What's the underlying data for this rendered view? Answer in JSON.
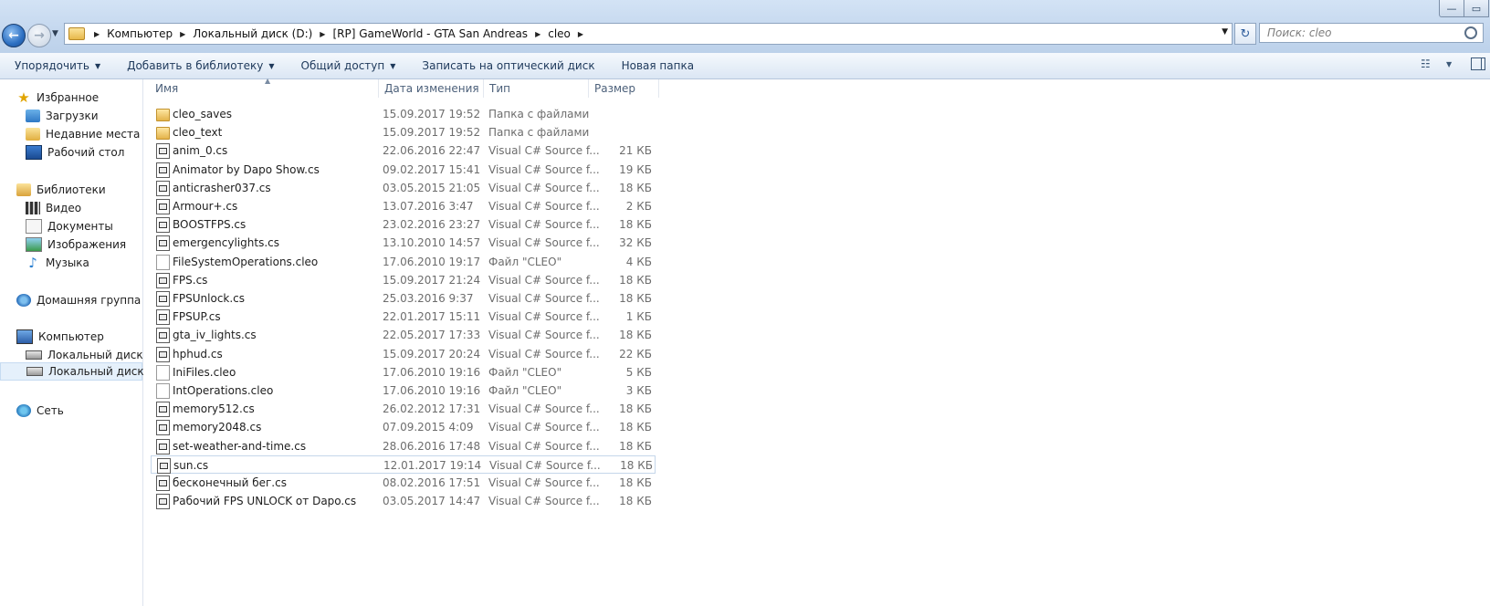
{
  "window": {
    "minimize_glyph": "—",
    "maximize_glyph": "▭"
  },
  "address": {
    "crumbs": [
      "Компьютер",
      "Локальный диск (D:)",
      "[RP] GameWorld - GTA San Andreas",
      "cleo"
    ]
  },
  "search": {
    "placeholder": "Поиск: cleo"
  },
  "commands": {
    "organize": "Упорядочить",
    "add_to_library": "Добавить в библиотеку",
    "share": "Общий доступ",
    "burn": "Записать на оптический диск",
    "new_folder": "Новая папка"
  },
  "nav": {
    "favorites": "Избранное",
    "downloads": "Загрузки",
    "recent": "Недавние места",
    "desktop": "Рабочий стол",
    "libraries": "Библиотеки",
    "video": "Видео",
    "documents": "Документы",
    "images": "Изображения",
    "music": "Музыка",
    "homegroup": "Домашняя группа",
    "computer": "Компьютер",
    "disk_c": "Локальный диск (C",
    "disk_d": "Локальный диск (D",
    "network": "Сеть"
  },
  "columns": {
    "name": "Имя",
    "date": "Дата изменения",
    "type": "Тип",
    "size": "Размер"
  },
  "files": [
    {
      "name": "cleo_saves",
      "date": "15.09.2017 19:52",
      "type": "Папка с файлами",
      "size": "",
      "kind": "folder"
    },
    {
      "name": "cleo_text",
      "date": "15.09.2017 19:52",
      "type": "Папка с файлами",
      "size": "",
      "kind": "folder"
    },
    {
      "name": "anim_0.cs",
      "date": "22.06.2016 22:47",
      "type": "Visual C# Source f...",
      "size": "21 КБ",
      "kind": "cs"
    },
    {
      "name": "Animator by Dapo Show.cs",
      "date": "09.02.2017 15:41",
      "type": "Visual C# Source f...",
      "size": "19 КБ",
      "kind": "cs"
    },
    {
      "name": "anticrasher037.cs",
      "date": "03.05.2015 21:05",
      "type": "Visual C# Source f...",
      "size": "18 КБ",
      "kind": "cs"
    },
    {
      "name": "Armour+.cs",
      "date": "13.07.2016 3:47",
      "type": "Visual C# Source f...",
      "size": "2 КБ",
      "kind": "cs"
    },
    {
      "name": "BOOSTFPS.cs",
      "date": "23.02.2016 23:27",
      "type": "Visual C# Source f...",
      "size": "18 КБ",
      "kind": "cs"
    },
    {
      "name": "emergencylights.cs",
      "date": "13.10.2010 14:57",
      "type": "Visual C# Source f...",
      "size": "32 КБ",
      "kind": "cs"
    },
    {
      "name": "FileSystemOperations.cleo",
      "date": "17.06.2010 19:17",
      "type": "Файл \"CLEO\"",
      "size": "4 КБ",
      "kind": "cleo"
    },
    {
      "name": "FPS.cs",
      "date": "15.09.2017 21:24",
      "type": "Visual C# Source f...",
      "size": "18 КБ",
      "kind": "cs"
    },
    {
      "name": "FPSUnlock.cs",
      "date": "25.03.2016 9:37",
      "type": "Visual C# Source f...",
      "size": "18 КБ",
      "kind": "cs"
    },
    {
      "name": "FPSUP.cs",
      "date": "22.01.2017 15:11",
      "type": "Visual C# Source f...",
      "size": "1 КБ",
      "kind": "cs"
    },
    {
      "name": "gta_iv_lights.cs",
      "date": "22.05.2017 17:33",
      "type": "Visual C# Source f...",
      "size": "18 КБ",
      "kind": "cs"
    },
    {
      "name": "hphud.cs",
      "date": "15.09.2017 20:24",
      "type": "Visual C# Source f...",
      "size": "22 КБ",
      "kind": "cs"
    },
    {
      "name": "IniFiles.cleo",
      "date": "17.06.2010 19:16",
      "type": "Файл \"CLEO\"",
      "size": "5 КБ",
      "kind": "cleo"
    },
    {
      "name": "IntOperations.cleo",
      "date": "17.06.2010 19:16",
      "type": "Файл \"CLEO\"",
      "size": "3 КБ",
      "kind": "cleo"
    },
    {
      "name": "memory512.cs",
      "date": "26.02.2012 17:31",
      "type": "Visual C# Source f...",
      "size": "18 КБ",
      "kind": "cs"
    },
    {
      "name": "memory2048.cs",
      "date": "07.09.2015 4:09",
      "type": "Visual C# Source f...",
      "size": "18 КБ",
      "kind": "cs"
    },
    {
      "name": "set-weather-and-time.cs",
      "date": "28.06.2016 17:48",
      "type": "Visual C# Source f...",
      "size": "18 КБ",
      "kind": "cs"
    },
    {
      "name": "sun.cs",
      "date": "12.01.2017 19:14",
      "type": "Visual C# Source f...",
      "size": "18 КБ",
      "kind": "cs",
      "selected": true
    },
    {
      "name": "бесконечный бег.cs",
      "date": "08.02.2016 17:51",
      "type": "Visual C# Source f...",
      "size": "18 КБ",
      "kind": "cs"
    },
    {
      "name": "Рабочий FPS UNLOCK от Dapo.cs",
      "date": "03.05.2017 14:47",
      "type": "Visual C# Source f...",
      "size": "18 КБ",
      "kind": "cs"
    }
  ]
}
